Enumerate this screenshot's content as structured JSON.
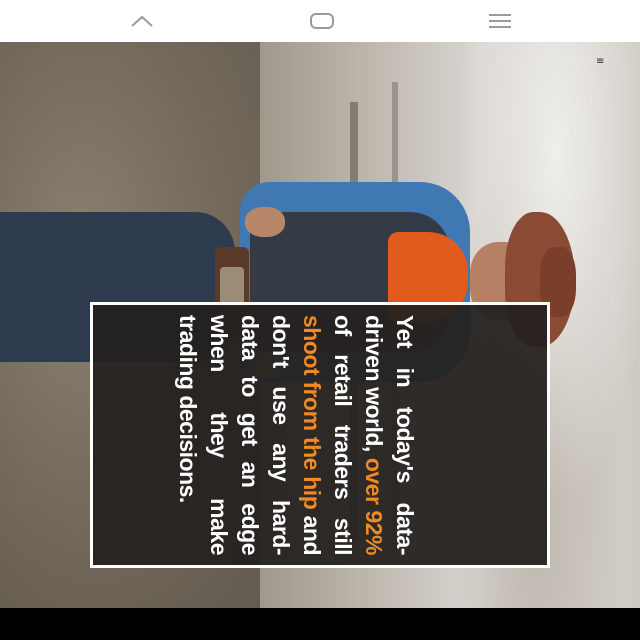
{
  "nav": {
    "up_icon": "chevron-up-icon",
    "home_icon": "rounded-rect-home-icon",
    "menu_icon": "hamburger-menu-icon"
  },
  "overlay": {
    "t1": "Yet in today's data-driven world, ",
    "h1": "over 92%",
    "t2": " of retail traders still ",
    "h2": "shoot from the hip",
    "t3": " and don't use any hard-data to get an edge when they make trading decisions."
  },
  "colors": {
    "highlight": "#f08a24",
    "card_bg": "#24211f",
    "text": "#ffffff"
  }
}
